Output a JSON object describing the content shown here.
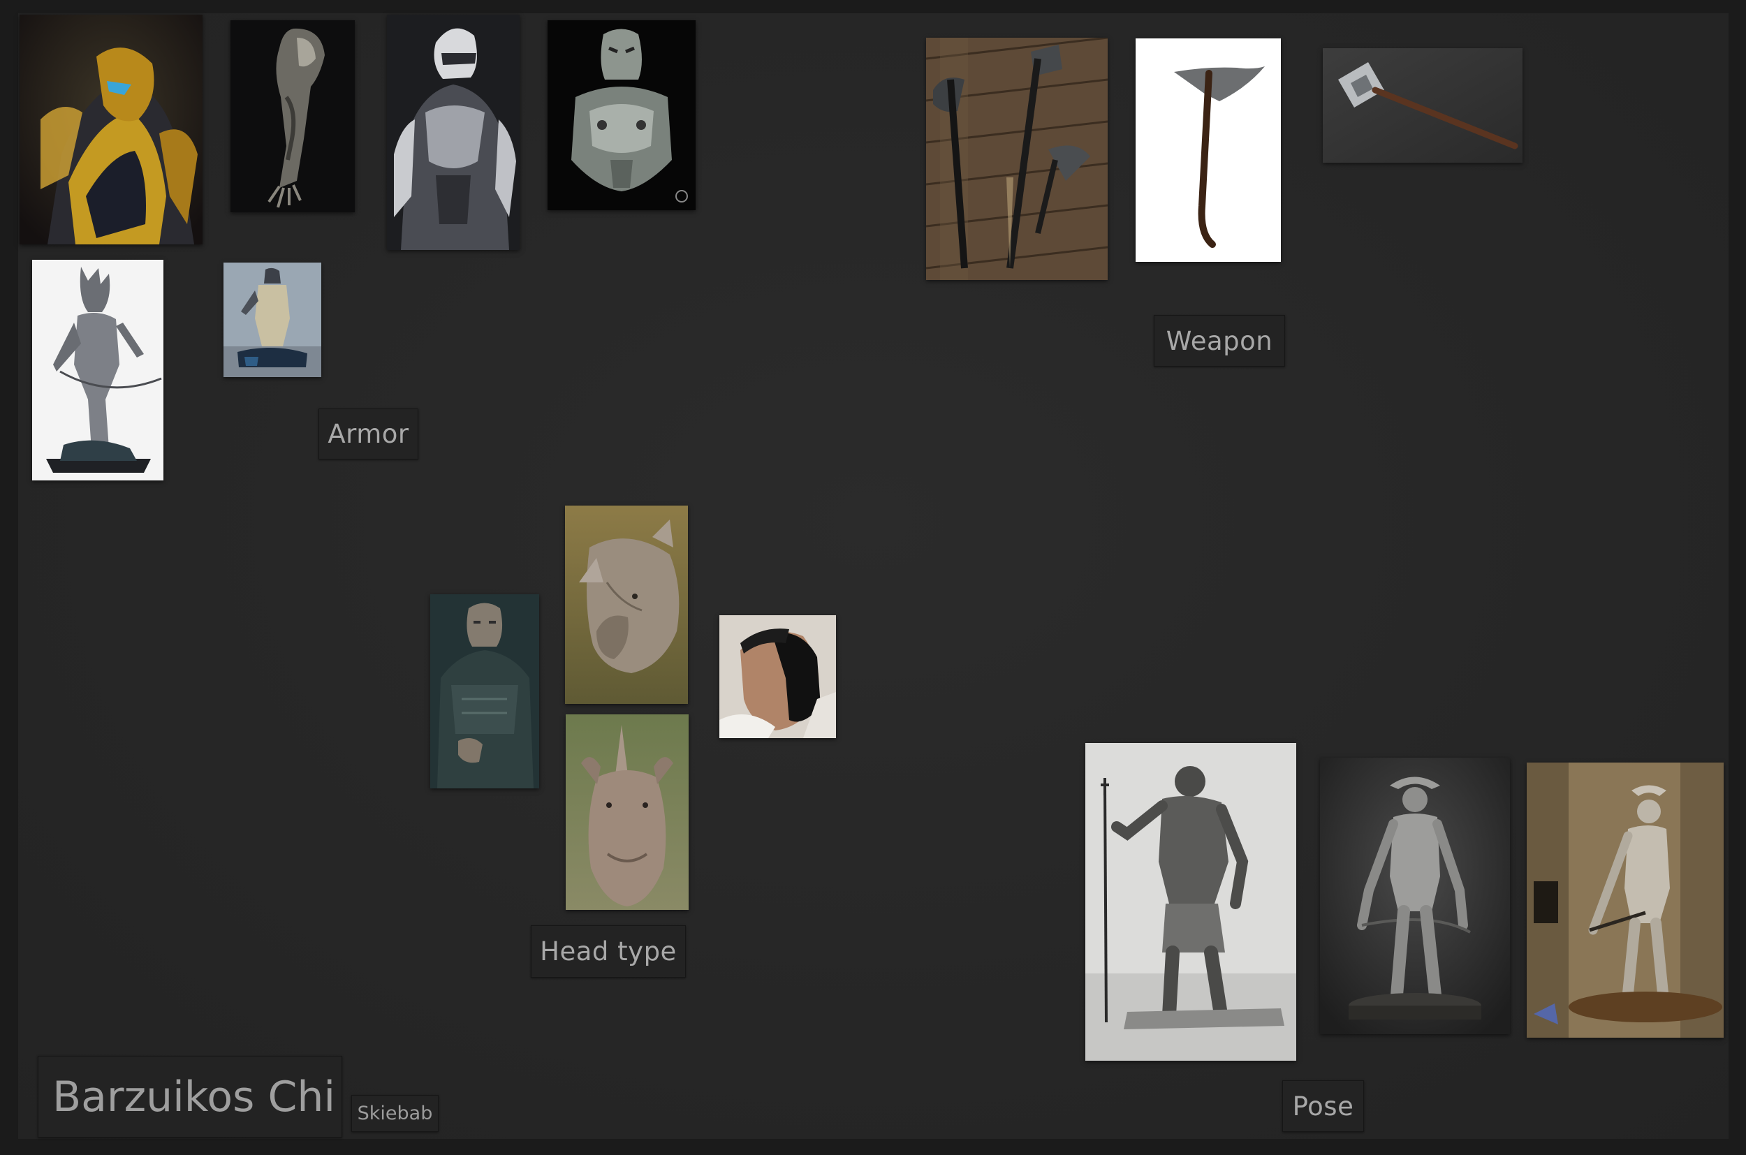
{
  "board": {
    "title": "Barzuikos Chi",
    "author": "Skiebab"
  },
  "groups": [
    {
      "id": "armor",
      "label": "Armor"
    },
    {
      "id": "weapon",
      "label": "Weapon"
    },
    {
      "id": "head",
      "label": "Head type"
    },
    {
      "id": "pose",
      "label": "Pose"
    }
  ],
  "colors": {
    "background": "#1b1b1b",
    "canvas": "#282828",
    "label_text": "#a8a8a8",
    "label_bg": "#232323"
  }
}
